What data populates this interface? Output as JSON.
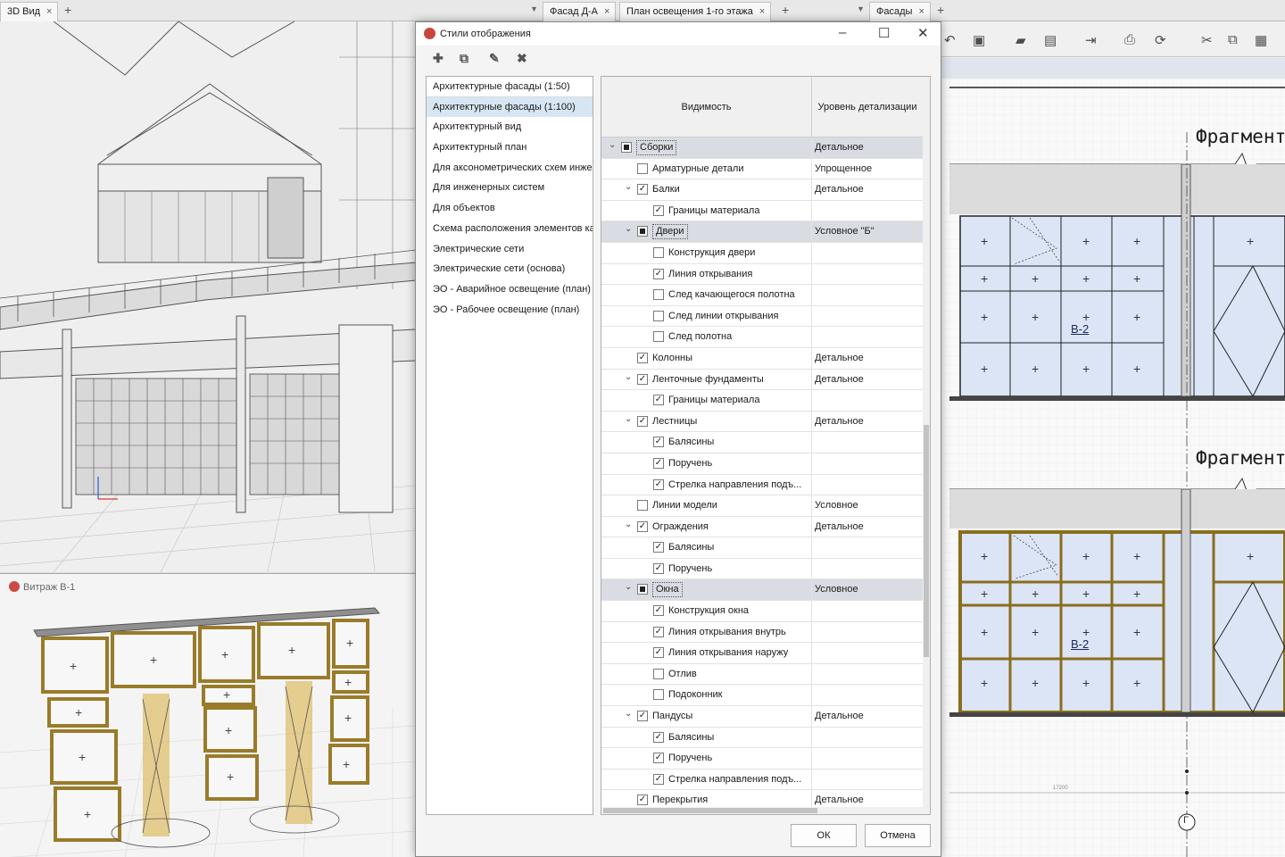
{
  "tabs_left": [
    {
      "label": "3D Вид"
    }
  ],
  "tabs_mid": [
    {
      "label": "Фасад Д-А"
    },
    {
      "label": "План освещения 1-го этажа"
    }
  ],
  "tabs_right": [
    {
      "label": "Фасады"
    }
  ],
  "icons": {
    "add": "+",
    "close": "×",
    "dropdown": "▼"
  },
  "view_b1": {
    "title": "Витраж В-1"
  },
  "dialog": {
    "title": "Стили отображения",
    "toolbar": {
      "add": "✚",
      "copy": "⧉",
      "edit": "✎",
      "delete": "✖"
    },
    "styles": [
      "Архитектурные фасады (1:50)",
      "Архитектурные фасады (1:100)",
      "Архитектурный вид",
      "Архитектурный план",
      "Для аксонометрических схем инженерных систем",
      "Для инженерных систем",
      "Для объектов",
      "Схема расположения элементов каркаса",
      "Электрические сети",
      "Электрические сети (основа)",
      "ЭО - Аварийное освещение (план)",
      "ЭО - Рабочее освещение (план)"
    ],
    "selected_style_index": 1,
    "columns": {
      "visibility": "Видимость",
      "detail": "Уровень детализации"
    },
    "rows": [
      {
        "level": 0,
        "expand": "v",
        "check": "mixed",
        "label": "Сборки",
        "detail": "Детальное",
        "highlight": true
      },
      {
        "level": 1,
        "expand": "",
        "check": "off",
        "label": "Арматурные детали",
        "detail": "Упрощенное"
      },
      {
        "level": 1,
        "expand": "v",
        "check": "on",
        "label": "Балки",
        "detail": "Детальное"
      },
      {
        "level": 2,
        "expand": "",
        "check": "on",
        "label": "Границы материала",
        "detail": ""
      },
      {
        "level": 1,
        "expand": "v",
        "check": "mixed",
        "label": "Двери",
        "detail": "Условное \"Б\"",
        "highlight": true
      },
      {
        "level": 2,
        "expand": "",
        "check": "off",
        "label": "Конструкция двери",
        "detail": ""
      },
      {
        "level": 2,
        "expand": "",
        "check": "on",
        "label": "Линия открывания",
        "detail": ""
      },
      {
        "level": 2,
        "expand": "",
        "check": "off",
        "label": "След качающегося полотна",
        "detail": ""
      },
      {
        "level": 2,
        "expand": "",
        "check": "off",
        "label": "След линии открывания",
        "detail": ""
      },
      {
        "level": 2,
        "expand": "",
        "check": "off",
        "label": "След полотна",
        "detail": ""
      },
      {
        "level": 1,
        "expand": "",
        "check": "on",
        "label": "Колонны",
        "detail": "Детальное"
      },
      {
        "level": 1,
        "expand": "v",
        "check": "on",
        "label": "Ленточные фундаменты",
        "detail": "Детальное"
      },
      {
        "level": 2,
        "expand": "",
        "check": "on",
        "label": "Границы материала",
        "detail": ""
      },
      {
        "level": 1,
        "expand": "v",
        "check": "on",
        "label": "Лестницы",
        "detail": "Детальное"
      },
      {
        "level": 2,
        "expand": "",
        "check": "on",
        "label": "Балясины",
        "detail": ""
      },
      {
        "level": 2,
        "expand": "",
        "check": "on",
        "label": "Поручень",
        "detail": ""
      },
      {
        "level": 2,
        "expand": "",
        "check": "on",
        "label": "Стрелка направления подъ...",
        "detail": ""
      },
      {
        "level": 1,
        "expand": "",
        "check": "off",
        "label": "Линии модели",
        "detail": "Условное"
      },
      {
        "level": 1,
        "expand": "v",
        "check": "on",
        "label": "Ограждения",
        "detail": "Детальное"
      },
      {
        "level": 2,
        "expand": "",
        "check": "on",
        "label": "Балясины",
        "detail": ""
      },
      {
        "level": 2,
        "expand": "",
        "check": "on",
        "label": "Поручень",
        "detail": ""
      },
      {
        "level": 1,
        "expand": "v",
        "check": "mixed",
        "label": "Окна",
        "detail": "Условное",
        "highlight": true
      },
      {
        "level": 2,
        "expand": "",
        "check": "on",
        "label": "Конструкция окна",
        "detail": ""
      },
      {
        "level": 2,
        "expand": "",
        "check": "on",
        "label": "Линия открывания внутрь",
        "detail": ""
      },
      {
        "level": 2,
        "expand": "",
        "check": "on",
        "label": "Линия открывания наружу",
        "detail": ""
      },
      {
        "level": 2,
        "expand": "",
        "check": "off",
        "label": "Отлив",
        "detail": ""
      },
      {
        "level": 2,
        "expand": "",
        "check": "off",
        "label": "Подоконник",
        "detail": ""
      },
      {
        "level": 1,
        "expand": "v",
        "check": "on",
        "label": "Пандусы",
        "detail": "Детальное"
      },
      {
        "level": 2,
        "expand": "",
        "check": "on",
        "label": "Балясины",
        "detail": ""
      },
      {
        "level": 2,
        "expand": "",
        "check": "on",
        "label": "Поручень",
        "detail": ""
      },
      {
        "level": 2,
        "expand": "",
        "check": "on",
        "label": "Стрелка направления подъ...",
        "detail": ""
      },
      {
        "level": 1,
        "expand": "",
        "check": "on",
        "label": "Перекрытия",
        "detail": "Детальное"
      }
    ],
    "ok": "ОК",
    "cancel": "Отмена"
  },
  "drawing": {
    "fragment_label_1": "Фрагмент",
    "fragment_label_2": "Фрагмент",
    "mark_1": "В-2",
    "mark_2": "В-2",
    "axis_label": "Г",
    "dimension": "17200"
  },
  "colors": {
    "accent": "#c9463f",
    "glass": "#dbe5f5",
    "frame_gold": "#d7b24a"
  }
}
